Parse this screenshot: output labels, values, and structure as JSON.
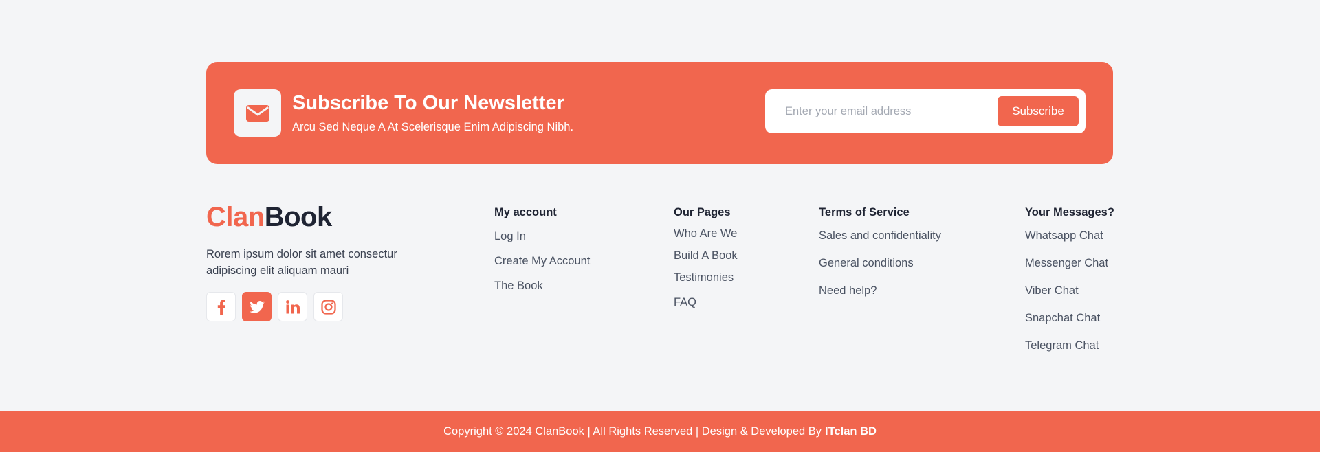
{
  "newsletter": {
    "title": "Subscribe To Our Newsletter",
    "subtitle": "Arcu Sed Neque A At Scelerisque Enim Adipiscing Nibh.",
    "email_placeholder": "Enter your email address",
    "button_label": "Subscribe",
    "icon": "envelope-icon"
  },
  "brand": {
    "part1": "Clan",
    "part2": "Boo",
    "part3": "k",
    "description": "Rorem ipsum dolor sit amet consectur adipiscing elit aliquam mauri"
  },
  "socials": [
    {
      "icon": "facebook-icon"
    },
    {
      "icon": "twitter-icon"
    },
    {
      "icon": "linkedin-icon"
    },
    {
      "icon": "instagram-icon"
    }
  ],
  "columns": {
    "account": {
      "heading": "My account",
      "links": [
        "Log In",
        "Create My Account",
        "The Book"
      ]
    },
    "pages": {
      "heading": "Our Pages",
      "links": [
        "Who Are We",
        "Build A Book",
        "Testimonies",
        "FAQ"
      ]
    },
    "terms": {
      "heading": "Terms of Service",
      "links": [
        "Sales and confidentiality",
        "General conditions",
        "Need help?"
      ]
    },
    "messages": {
      "heading": "Your Messages?",
      "links": [
        "Whatsapp Chat",
        "Messenger Chat",
        "Viber Chat",
        "Snapchat Chat",
        "Telegram Chat"
      ]
    }
  },
  "footer": {
    "copyright": "Copyright © 2024 ClanBook | All Rights Reserved | Design & Developed By",
    "developer": "ITclan BD"
  },
  "colors": {
    "accent": "#f1664e",
    "background": "#f4f5f7",
    "dark": "#1f2433"
  }
}
